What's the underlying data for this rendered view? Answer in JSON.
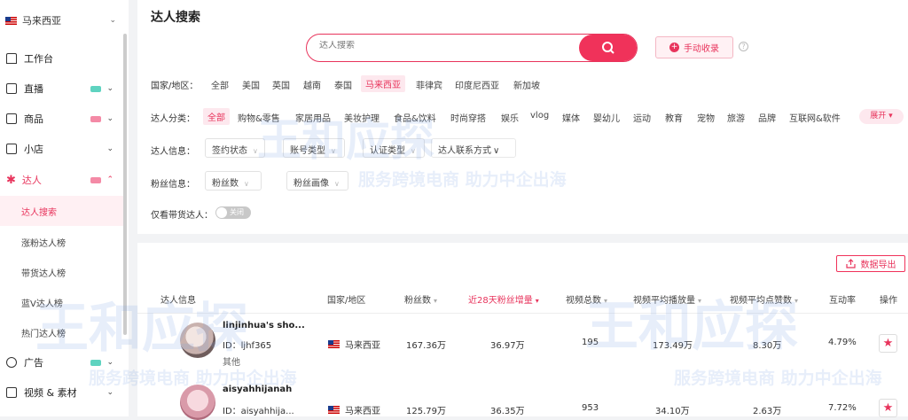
{
  "sidebar": {
    "region": "马来西亚",
    "items": [
      {
        "label": "工作台"
      },
      {
        "label": "直播"
      },
      {
        "label": "商品"
      },
      {
        "label": "小店"
      },
      {
        "label": "达人"
      },
      {
        "label": "广告"
      },
      {
        "label": "视频 & 素材"
      }
    ],
    "sub_items": [
      {
        "label": "达人搜索"
      },
      {
        "label": "涨粉达人榜"
      },
      {
        "label": "带货达人榜"
      },
      {
        "label": "蓝V达人榜"
      },
      {
        "label": "热门达人榜"
      }
    ],
    "tag_colors": {
      "green": "#5fd3c0",
      "pink": "#f48aa6"
    }
  },
  "page": {
    "title": "达人搜索",
    "search_placeholder": "达人搜索",
    "manual_button": "手动收录"
  },
  "filters": {
    "region_label": "国家/地区：",
    "regions": [
      "全部",
      "美国",
      "英国",
      "越南",
      "泰国",
      "马来西亚",
      "菲律宾",
      "印度尼西亚",
      "新加坡"
    ],
    "category_label": "达人分类：",
    "categories": [
      "全部",
      "购物&零售",
      "家居用品",
      "美妆护理",
      "食品&饮料",
      "时尚穿搭",
      "娱乐",
      "vlog",
      "媒体",
      "婴幼儿",
      "运动",
      "教育",
      "宠物",
      "旅游",
      "品牌",
      "互联网&软件"
    ],
    "expand_label": "展开",
    "info_label": "达人信息：",
    "info_dropdowns": [
      "签约状态",
      "账号类型",
      "认证类型",
      "达人联系方式"
    ],
    "fans_label": "粉丝信息：",
    "fans_dropdowns": [
      "粉丝数",
      "粉丝画像"
    ],
    "goods_only_label": "仅看带货达人：",
    "toggle_text": "关闭"
  },
  "table": {
    "export_label": "数据导出",
    "headers": [
      "达人信息",
      "国家/地区",
      "粉丝数",
      "近28天粉丝增量",
      "视频总数",
      "视频平均播放量",
      "视频平均点赞数",
      "互动率",
      "操作"
    ],
    "rows": [
      {
        "name": "linjinhua's sho...",
        "id": "ID：ljhf365",
        "category": "其他",
        "region": "马来西亚",
        "fans": "167.36万",
        "growth": "36.97万",
        "videos": "195",
        "avg_play": "173.49万",
        "avg_like": "8.30万",
        "engagement": "4.79%"
      },
      {
        "name": "aisyahhijanah",
        "id": "ID：aisyahhija...",
        "category": "",
        "region": "马来西亚",
        "fans": "125.79万",
        "growth": "36.35万",
        "videos": "953",
        "avg_play": "34.10万",
        "avg_like": "2.63万",
        "engagement": "7.72%"
      }
    ]
  },
  "watermark": {
    "brand": "王和应探",
    "slogan": "服务跨境电商 助力中企出海"
  },
  "colors": {
    "accent": "#e8345c",
    "selected_bg": "#fde8ee"
  }
}
